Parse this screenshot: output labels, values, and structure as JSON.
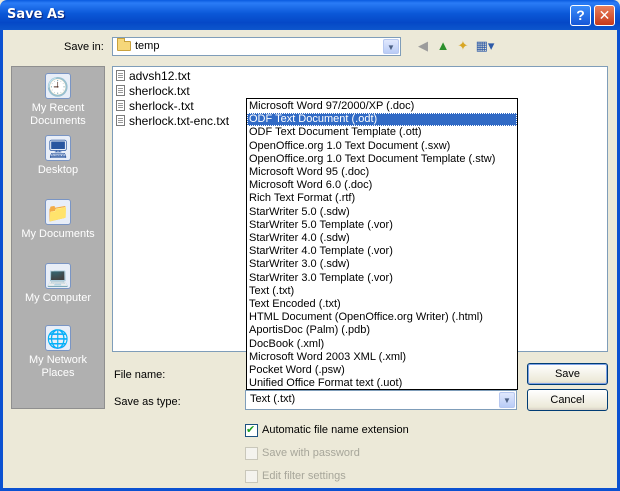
{
  "window": {
    "title": "Save As",
    "help_label": "?",
    "close_label": "✕"
  },
  "save_in": {
    "label": "Save in:",
    "value": "temp"
  },
  "places": [
    {
      "label": "My Recent Documents",
      "icon": "recent-documents-icon",
      "glyph": "🕘"
    },
    {
      "label": "Desktop",
      "icon": "desktop-icon",
      "glyph": "🖥"
    },
    {
      "label": "My Documents",
      "icon": "my-documents-icon",
      "glyph": "📁"
    },
    {
      "label": "My Computer",
      "icon": "my-computer-icon",
      "glyph": "💻"
    },
    {
      "label": "My Network Places",
      "icon": "network-places-icon",
      "glyph": "🌐"
    }
  ],
  "files": [
    "advsh12.txt",
    "sherlock.txt",
    "sherlock-.txt",
    "sherlock.txt-enc.txt"
  ],
  "file_name": {
    "label": "File name:",
    "value": ""
  },
  "save_as_type": {
    "label": "Save as type:",
    "value": "Text (.txt)",
    "options": [
      "Microsoft Word 97/2000/XP (.doc)",
      "ODF Text Document (.odt)",
      "ODF Text Document Template (.ott)",
      "OpenOffice.org 1.0 Text Document (.sxw)",
      "OpenOffice.org 1.0 Text Document Template (.stw)",
      "Microsoft Word 95 (.doc)",
      "Microsoft Word 6.0 (.doc)",
      "Rich Text Format (.rtf)",
      "StarWriter 5.0 (.sdw)",
      "StarWriter 5.0 Template (.vor)",
      "StarWriter 4.0 (.sdw)",
      "StarWriter 4.0 Template (.vor)",
      "StarWriter 3.0 (.sdw)",
      "StarWriter 3.0 Template (.vor)",
      "Text (.txt)",
      "Text Encoded (.txt)",
      "HTML Document (OpenOffice.org Writer) (.html)",
      "AportisDoc (Palm) (.pdb)",
      "DocBook (.xml)",
      "Microsoft Word 2003 XML (.xml)",
      "Pocket Word (.psw)",
      "Unified Office Format text (.uot)"
    ],
    "selected_index": 1
  },
  "buttons": {
    "save": "Save",
    "cancel": "Cancel"
  },
  "options": {
    "auto_extension": {
      "label": "Automatic file name extension",
      "checked": true
    },
    "save_with_password": {
      "label": "Save with password",
      "checked": false
    },
    "edit_filter_settings": {
      "label": "Edit filter settings",
      "checked": false
    }
  },
  "colors": {
    "titlebar": "#0b58d8",
    "selection": "#316ac5",
    "dialog_bg": "#ece9d8"
  }
}
